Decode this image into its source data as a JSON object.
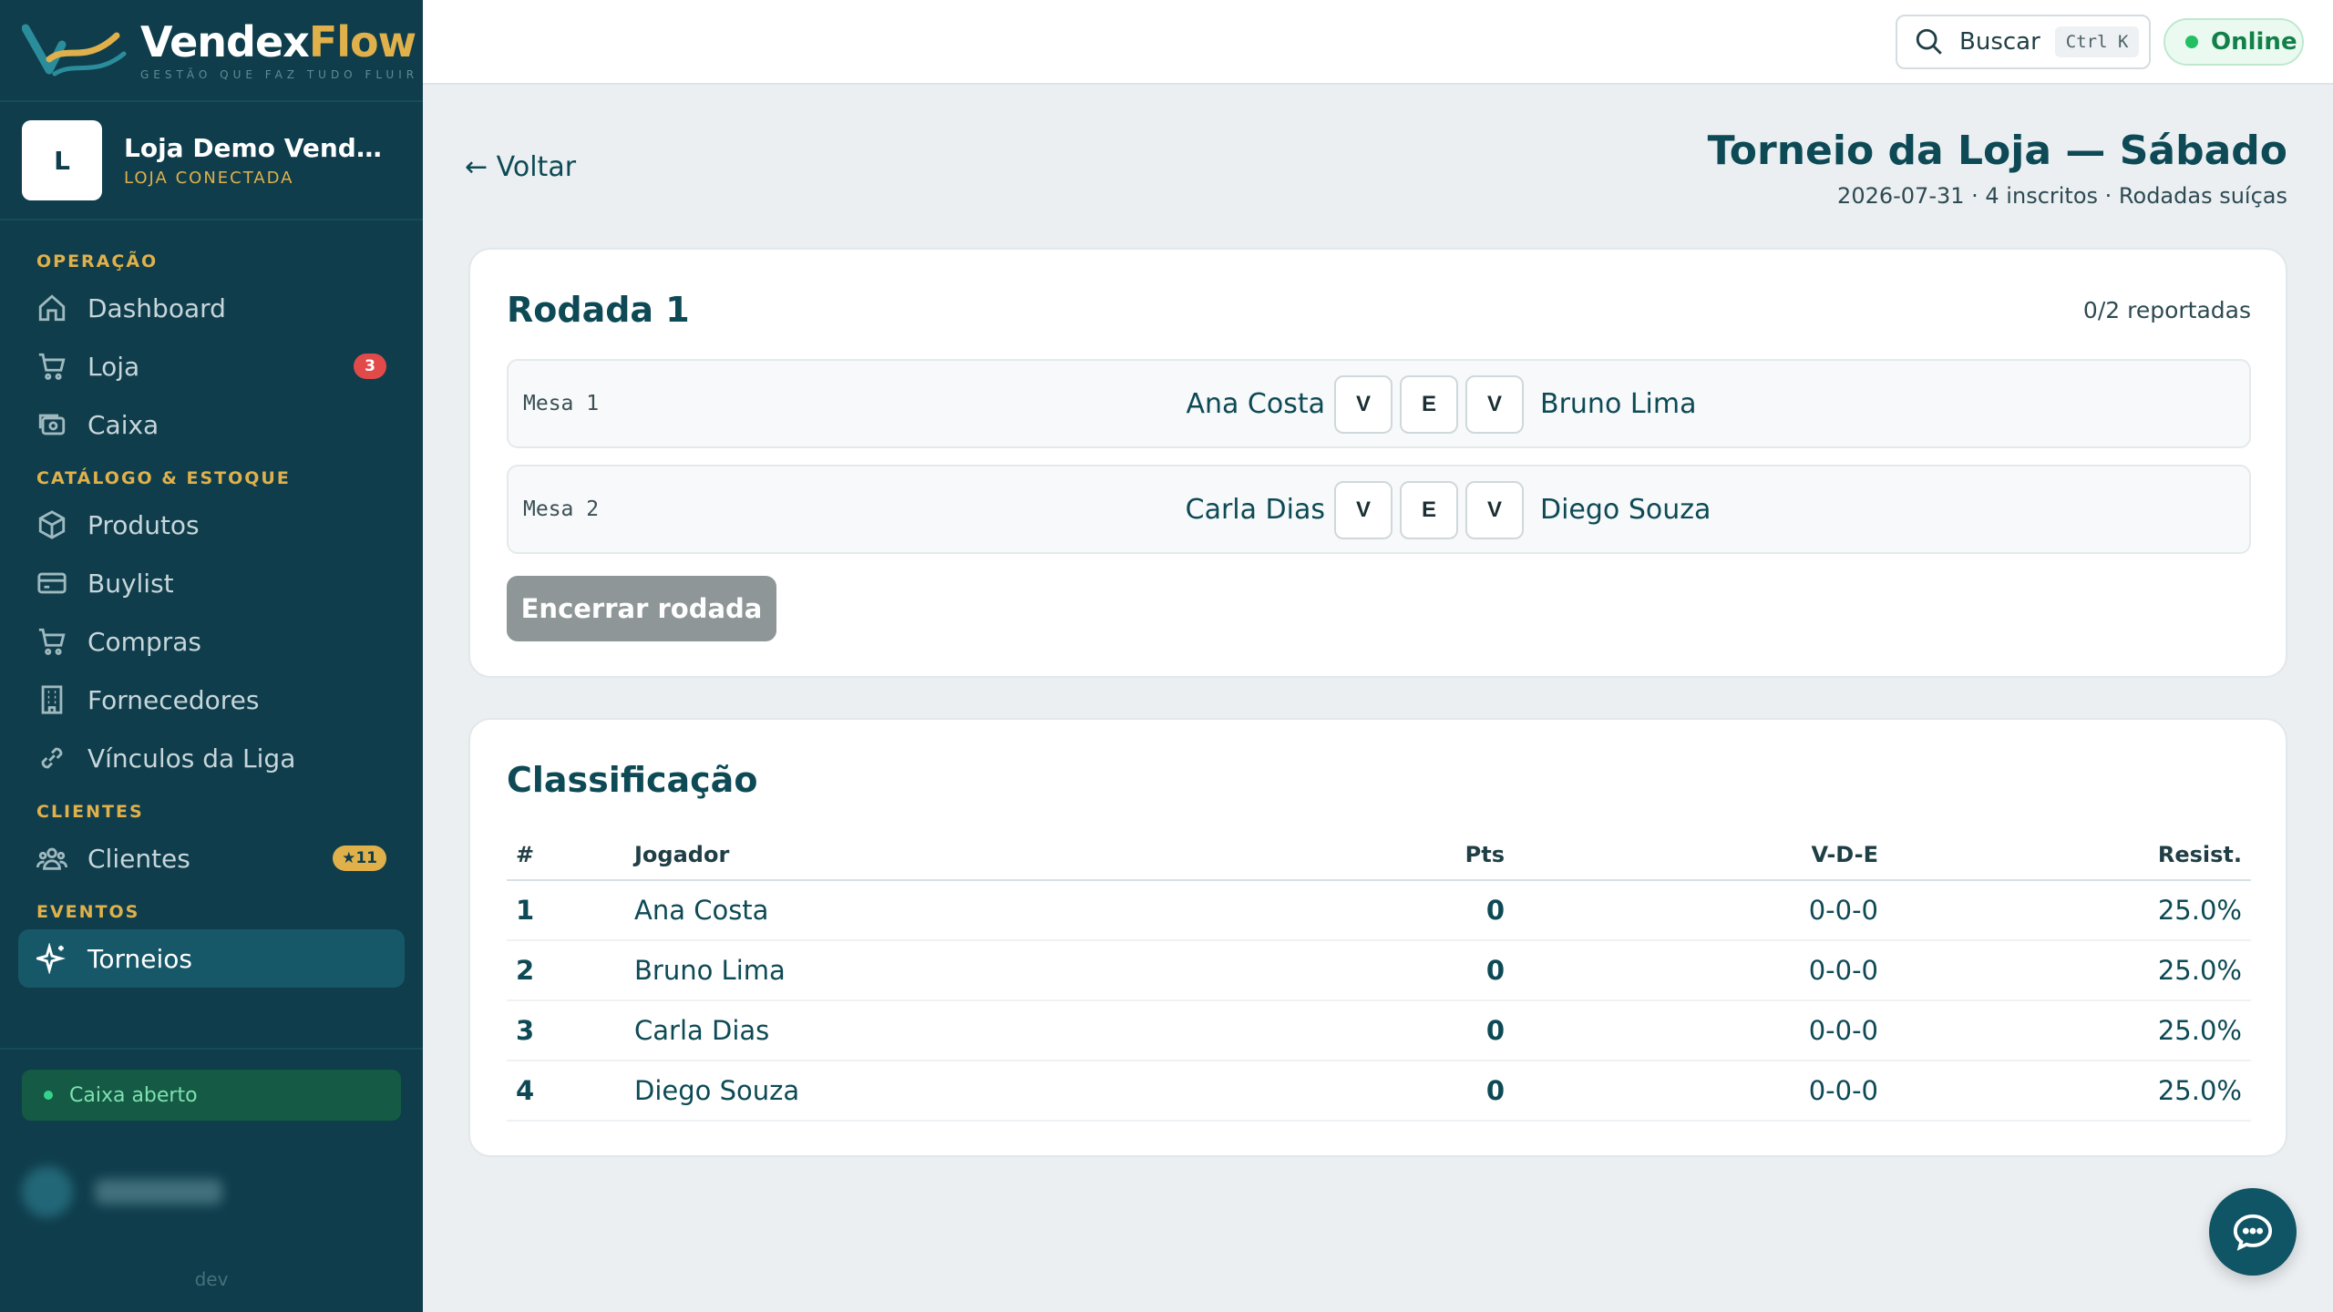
{
  "brand": {
    "name_main": "Vendex",
    "name_accent": "Flow",
    "tagline": "GESTÃO QUE FAZ TUDO FLUIR"
  },
  "store": {
    "initial": "L",
    "name": "Loja Demo VendexFl...",
    "status": "LOJA CONECTADA"
  },
  "nav": {
    "sections": {
      "operacao": "OPERAÇÃO",
      "catalogo": "CATÁLOGO & ESTOQUE",
      "clientes": "CLIENTES",
      "eventos": "EVENTOS"
    },
    "items": {
      "dashboard": "Dashboard",
      "loja": "Loja",
      "loja_badge": "3",
      "caixa": "Caixa",
      "produtos": "Produtos",
      "buylist": "Buylist",
      "compras": "Compras",
      "fornecedores": "Fornecedores",
      "vinculos": "Vínculos da Liga",
      "clientes": "Clientes",
      "clientes_badge": "★11",
      "torneios": "Torneios"
    }
  },
  "sidebar_footer": {
    "cash_status": "Caixa aberto",
    "env": "dev"
  },
  "topbar": {
    "search_label": "Buscar",
    "search_shortcut": "Ctrl K",
    "status": "Online"
  },
  "page": {
    "back_label": "← Voltar",
    "title": "Torneio da Loja — Sábado",
    "subtitle": "2026-07-31 · 4 inscritos · Rodadas suíças"
  },
  "round": {
    "title": "Rodada 1",
    "reported": "0/2 reportadas",
    "matches": [
      {
        "table": "Mesa 1",
        "player_a": "Ana Costa",
        "player_b": "Bruno Lima",
        "buttons": [
          "V",
          "E",
          "V"
        ]
      },
      {
        "table": "Mesa 2",
        "player_a": "Carla Dias",
        "player_b": "Diego Souza",
        "buttons": [
          "V",
          "E",
          "V"
        ]
      }
    ],
    "end_button": "Encerrar rodada"
  },
  "standings": {
    "title": "Classificação",
    "headers": {
      "rank": "#",
      "player": "Jogador",
      "pts": "Pts",
      "vde": "V-D-E",
      "res": "Resist."
    },
    "rows": [
      {
        "rank": "1",
        "player": "Ana Costa",
        "pts": "0",
        "vde": "0-0-0",
        "res": "25.0%"
      },
      {
        "rank": "2",
        "player": "Bruno Lima",
        "pts": "0",
        "vde": "0-0-0",
        "res": "25.0%"
      },
      {
        "rank": "3",
        "player": "Carla Dias",
        "pts": "0",
        "vde": "0-0-0",
        "res": "25.0%"
      },
      {
        "rank": "4",
        "player": "Diego Souza",
        "pts": "0",
        "vde": "0-0-0",
        "res": "25.0%"
      }
    ]
  },
  "colors": {
    "sidebar_bg": "#0f3d4c",
    "accent_gold": "#e0b14a",
    "primary_text": "#0d4a55",
    "online_green": "#22c063",
    "badge_red": "#e24a4a"
  },
  "icons": {
    "dashboard": "home-icon",
    "loja": "cart-icon",
    "caixa": "cash-icon",
    "produtos": "box-icon",
    "buylist": "card-icon",
    "compras": "cart-icon",
    "fornecedores": "building-icon",
    "vinculos": "link-icon",
    "clientes": "users-icon",
    "torneios": "sparkle-icon",
    "search": "search-icon",
    "chat": "chat-icon"
  }
}
